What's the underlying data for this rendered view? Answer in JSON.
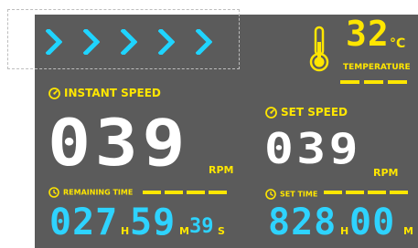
{
  "indicators": {
    "chevron_count": 5,
    "chevron_color": "#1fd4ff"
  },
  "temperature": {
    "value": "32",
    "unit": "°C",
    "label": "TEMPERATURE",
    "accent": "#ffe600",
    "icon": "thermometer-icon"
  },
  "instant_speed": {
    "label": "INSTANT SPEED",
    "value": "039",
    "unit": "RPM",
    "icon": "gauge-icon"
  },
  "set_speed": {
    "label": "SET SPEED",
    "value": "039",
    "unit": "RPM",
    "icon": "gauge-icon"
  },
  "remaining_time": {
    "label": "REMAINING TIME",
    "hours": "027",
    "h_unit": "H",
    "minutes": "59",
    "m_unit": "M",
    "seconds": "39",
    "s_unit": "S",
    "icon": "clock-icon"
  },
  "set_time": {
    "label": "SET TIME",
    "hours": "828",
    "h_unit": "H",
    "minutes": "00",
    "m_unit": "M",
    "icon": "clock-icon"
  },
  "colors": {
    "background": "#5b5b5b",
    "primary_yellow": "#ffe600",
    "cyan": "#2ed3ff",
    "white": "#ffffff"
  }
}
